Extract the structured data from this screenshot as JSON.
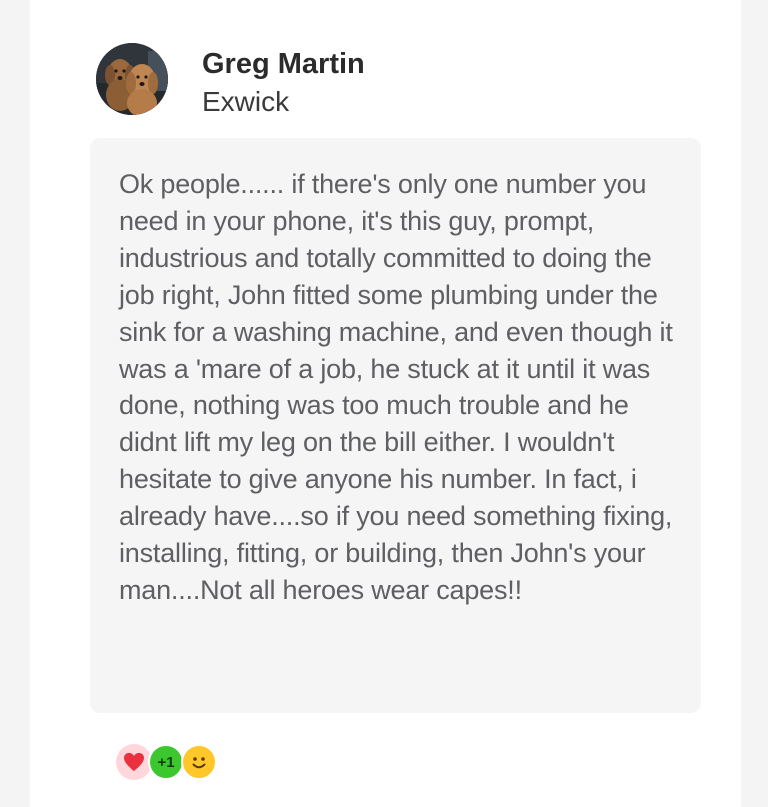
{
  "review": {
    "author_name": "Greg Martin",
    "author_location": "Exwick",
    "text": "Ok people...... if there's only one number you need in your phone, it's this guy, prompt, industrious and totally committed to doing the job right, John fitted some plumbing under the sink for a washing machine, and even though it was a 'mare of a job, he stuck at it until it was done, nothing was too much trouble and he didnt lift my leg on the bill either. I wouldn't hesitate to give anyone his number. In fact, i already have....so if you need something fixing, installing, fitting, or building, then John's your man....Not all heroes wear capes!!",
    "reactions": [
      {
        "icon": "heart-icon",
        "label": ""
      },
      {
        "icon": "plus-one-icon",
        "label": "+1"
      },
      {
        "icon": "smile-icon",
        "label": ""
      }
    ]
  },
  "colors": {
    "card_background": "#ffffff",
    "page_background": "#f4f4f4",
    "review_box_background": "#f5f5f6",
    "review_text": "#5f5f63",
    "heart": "#e8323f",
    "plus_one": "#3cc72f",
    "smile": "#ffc72a"
  }
}
